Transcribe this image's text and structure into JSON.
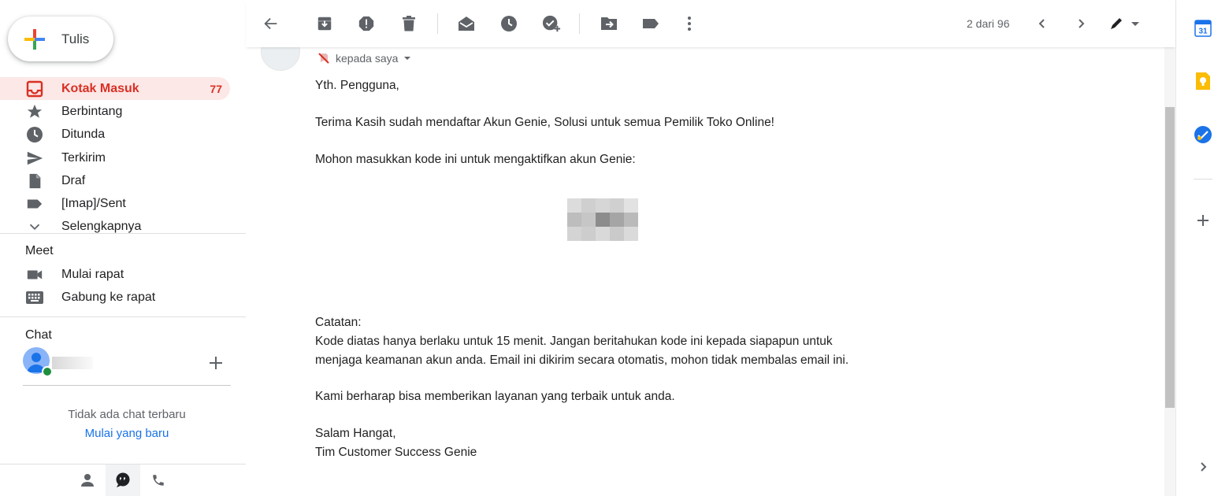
{
  "compose": {
    "label": "Tulis",
    "icon": "plus-multicolor-icon"
  },
  "nav": {
    "items": [
      {
        "label": "Kotak Masuk",
        "count": "77",
        "icon": "inbox-icon",
        "active": true
      },
      {
        "label": "Berbintang",
        "icon": "star-icon"
      },
      {
        "label": "Ditunda",
        "icon": "clock-icon"
      },
      {
        "label": "Terkirim",
        "icon": "send-icon"
      },
      {
        "label": "Draf",
        "icon": "draft-icon"
      },
      {
        "label": "[Imap]/Sent",
        "icon": "label-icon"
      },
      {
        "label": "Selengkapnya",
        "icon": "chevron-down-icon"
      }
    ]
  },
  "meet": {
    "title": "Meet",
    "items": [
      {
        "label": "Mulai rapat",
        "icon": "video-icon"
      },
      {
        "label": "Gabung ke rapat",
        "icon": "keyboard-icon"
      }
    ]
  },
  "chat": {
    "title": "Chat",
    "empty_text": "Tidak ada chat terbaru",
    "start_new": "Mulai yang baru"
  },
  "toolbar": {
    "pager_text": "2 dari 96",
    "icons": [
      "back-arrow-icon",
      "archive-icon",
      "report-spam-icon",
      "delete-icon",
      "mark-unread-icon",
      "snooze-icon",
      "add-task-icon",
      "move-to-icon",
      "label-icon",
      "more-vert-icon",
      "prev-icon",
      "next-icon",
      "input-tools-icon"
    ]
  },
  "email": {
    "recipient": "kepada saya",
    "greeting": "Yth. Pengguna,",
    "line1": "Terima Kasih sudah mendaftar Akun Genie, Solusi untuk semua Pemilik Toko Online!",
    "line2": "Mohon masukkan kode ini untuk mengaktifkan akun Genie:",
    "note_title": "Catatan:",
    "note_line1": "Kode diatas hanya berlaku untuk 15 menit. Jangan beritahukan kode ini kepada siapapun untuk",
    "note_line2": "menjaga keamanan akun anda. Email ini dikirim secara otomatis, mohon tidak membalas email ini.",
    "line3": "Kami berharap bisa memberikan layanan yang terbaik untuk anda.",
    "closing": "Salam Hangat,",
    "signature": "Tim Customer Success Genie"
  },
  "right_panel": {
    "icons": [
      "calendar-icon",
      "keep-icon",
      "tasks-icon",
      "add-addon-icon",
      "expand-panel-icon"
    ],
    "calendar_day": "31"
  },
  "colors": {
    "accent_red": "#d93025",
    "active_bg": "#fce8e6",
    "link_blue": "#1a73e8",
    "icon_grey": "#5f6368"
  }
}
